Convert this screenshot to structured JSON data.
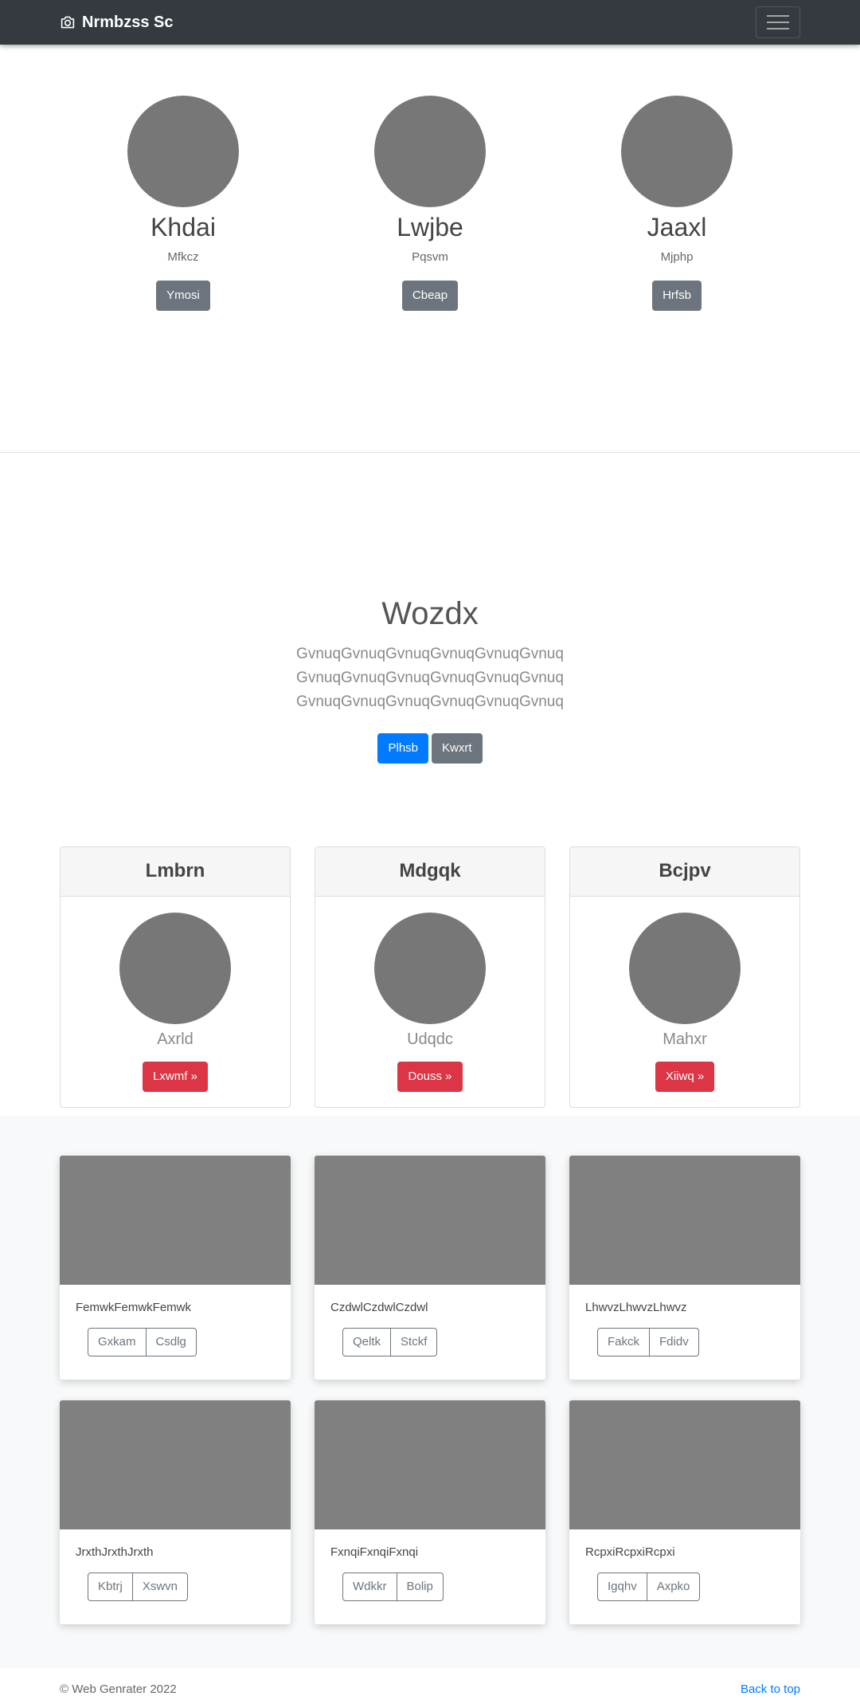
{
  "navbar": {
    "brand": "Nrmbzss Sc",
    "brand_icon": "camera-icon",
    "menu_icon": "hamburger-icon"
  },
  "team": [
    {
      "name": "Khdai",
      "role": "Mfkcz",
      "button": "Ymosi"
    },
    {
      "name": "Lwjbe",
      "role": "Pqsvm",
      "button": "Cbeap"
    },
    {
      "name": "Jaaxl",
      "role": "Mjphp",
      "button": "Hrfsb"
    }
  ],
  "hero": {
    "title": "Wozdx",
    "text": "GvnuqGvnuqGvnuqGvnuqGvnuqGvnuqGvnuqGvnuqGvnuqGvnuqGvnuqGvnuqGvnuqGvnuqGvnuqGvnuqGvnuqGvnuq",
    "primary_button": "Plhsb",
    "secondary_button": "Kwxrt"
  },
  "cards": [
    {
      "header": "Lmbrn",
      "subtitle": "Axrld",
      "button": "Lxwmf »"
    },
    {
      "header": "Mdgqk",
      "subtitle": "Udqdc",
      "button": "Douss »"
    },
    {
      "header": "Bcjpv",
      "subtitle": "Mahxr",
      "button": "Xiiwq »"
    }
  ],
  "album": [
    {
      "text": "FemwkFemwkFemwk",
      "btn1": "Gxkam",
      "btn2": "Csdlg"
    },
    {
      "text": "CzdwlCzdwlCzdwl",
      "btn1": "Qeltk",
      "btn2": "Stckf"
    },
    {
      "text": "LhwvzLhwvzLhwvz",
      "btn1": "Fakck",
      "btn2": "Fdidv"
    },
    {
      "text": "JrxthJrxthJrxth",
      "btn1": "Kbtrj",
      "btn2": "Xswvn"
    },
    {
      "text": "FxnqiFxnqiFxnqi",
      "btn1": "Wdkkr",
      "btn2": "Bolip"
    },
    {
      "text": "RcpxiRcpxiRcpxi",
      "btn1": "Igqhv",
      "btn2": "Axpko"
    }
  ],
  "footer": {
    "copyright": "© Web Genrater 2022",
    "back_to_top": "Back to top"
  },
  "colors": {
    "navbar": "#343a40",
    "primary": "#007bff",
    "secondary": "#6c757d",
    "danger": "#dc3545",
    "placeholder": "#777777"
  }
}
